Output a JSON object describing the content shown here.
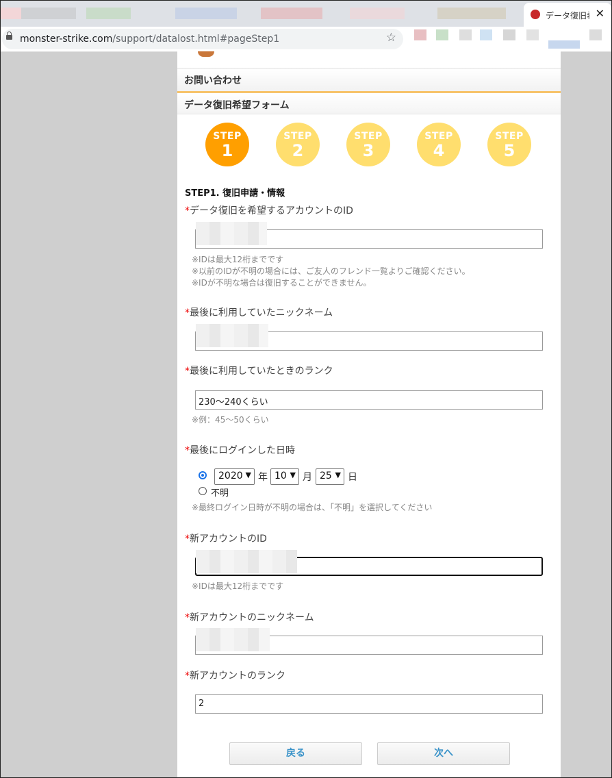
{
  "browser": {
    "tab_title": "データ復旧希",
    "tab_close": "✕",
    "url_host": "monster-strike.com",
    "url_path": "/support/datalost.html#pageStep1",
    "bookmark_icon": "star-icon"
  },
  "page": {
    "header": "お問い合わせ",
    "subheader": "データ復旧希望フォーム",
    "steps": [
      {
        "label": "STEP",
        "num": "1",
        "active": true
      },
      {
        "label": "STEP",
        "num": "2",
        "active": false
      },
      {
        "label": "STEP",
        "num": "3",
        "active": false
      },
      {
        "label": "STEP",
        "num": "4",
        "active": false
      },
      {
        "label": "STEP",
        "num": "5",
        "active": false
      }
    ],
    "section_title": "STEP1. 復旧申請・情報",
    "required_mark": "*",
    "fields": {
      "old_id": {
        "label": "データ復旧を希望するアカウントのID",
        "value": "",
        "notes": [
          "※IDは最大12桁までです",
          "※以前のIDが不明の場合には、ご友人のフレンド一覧よりご確認ください。",
          "※IDが不明な場合は復旧することができません。"
        ]
      },
      "old_nickname": {
        "label": "最後に利用していたニックネーム",
        "value": ""
      },
      "old_rank": {
        "label": "最後に利用していたときのランク",
        "value": "230〜240くらい",
        "note": "※例：45〜50くらい"
      },
      "last_login": {
        "label": "最後にログインした日時",
        "year": "2020",
        "year_unit": "年",
        "month": "10",
        "month_unit": "月",
        "day": "25",
        "day_unit": "日",
        "unknown_label": "不明",
        "note": "※最終ログイン日時が不明の場合は、「不明」を選択してください"
      },
      "new_id": {
        "label": "新アカウントのID",
        "value": "",
        "note": "※IDは最大12桁までです"
      },
      "new_nickname": {
        "label": "新アカウントのニックネーム",
        "value": ""
      },
      "new_rank": {
        "label": "新アカウントのランク",
        "value": "2"
      }
    },
    "buttons": {
      "back": "戻る",
      "next": "次へ"
    }
  }
}
